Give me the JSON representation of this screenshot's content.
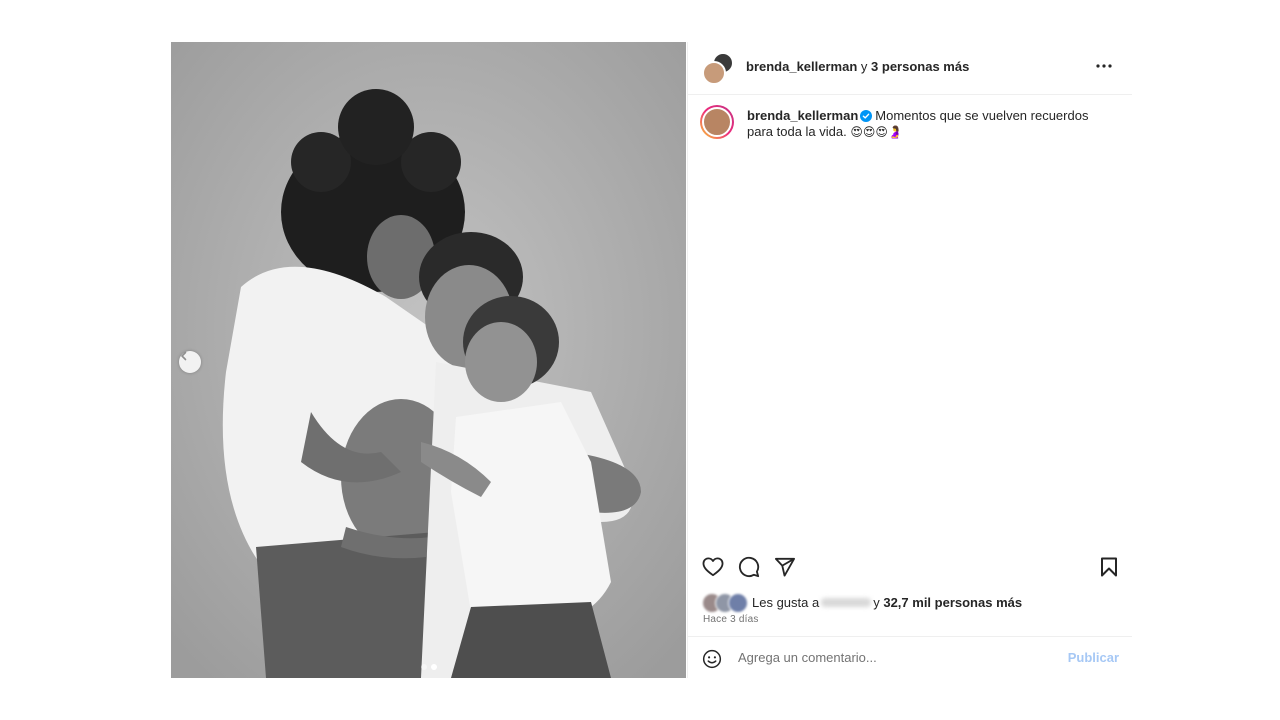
{
  "header": {
    "username": "brenda_kellerman",
    "collab_prefix": "y",
    "collab_count": "3 personas más",
    "menu_icon": "more-horizontal-icon"
  },
  "caption": {
    "username": "brenda_kellerman",
    "verified_icon": "verified-badge-icon",
    "text": "Momentos que se vuelven recuerdos para toda la vida.",
    "emojis": "😍😍😍🤰"
  },
  "actions": {
    "like_icon": "heart-icon",
    "comment_icon": "comment-icon",
    "share_icon": "send-icon",
    "save_icon": "bookmark-icon"
  },
  "likes": {
    "prefix": "Les gusta a",
    "connector": "y",
    "count": "32,7 mil personas más"
  },
  "timestamp": "Hace 3 días",
  "comment": {
    "placeholder": "Agrega un comentario...",
    "publish_label": "Publicar"
  },
  "carousel": {
    "total": 2,
    "current": 2
  },
  "colors": {
    "accent_blue": "#0095f6",
    "publish_disabled": "#a6c8f5",
    "muted_text": "#737373"
  }
}
